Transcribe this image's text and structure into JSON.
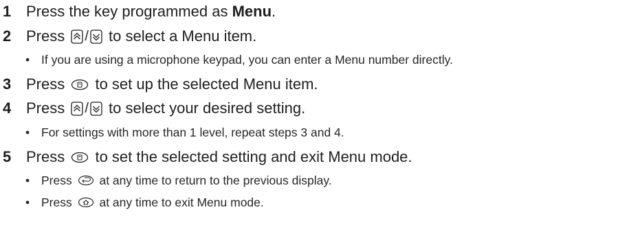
{
  "steps": [
    {
      "num": "1",
      "pre": "Press the key programmed as ",
      "bold": "Menu",
      "post": "."
    },
    {
      "num": "2",
      "pre": "Press ",
      "slash": "/",
      "post": " to select a Menu item.",
      "notes": [
        "If you are using a microphone keypad, you can enter a Menu number directly."
      ]
    },
    {
      "num": "3",
      "pre": "Press ",
      "post": " to set up the selected Menu item."
    },
    {
      "num": "4",
      "pre": "Press ",
      "slash": "/",
      "post": " to select your desired setting.",
      "notes": [
        "For settings with more than 1 level, repeat steps 3 and 4."
      ]
    },
    {
      "num": "5",
      "pre": "Press ",
      "post": " to set the selected setting and exit Menu mode.",
      "notes": [
        {
          "pre": "Press ",
          "post": " at any time to return to the previous display."
        },
        {
          "pre": "Press ",
          "post": " at any time to exit Menu mode."
        }
      ]
    }
  ],
  "bullet": "•",
  "icons": {
    "up": "up-arrow-key-icon",
    "down": "down-arrow-key-icon",
    "menu": "menu-key-icon",
    "back": "back-key-icon",
    "exit": "exit-key-icon"
  }
}
